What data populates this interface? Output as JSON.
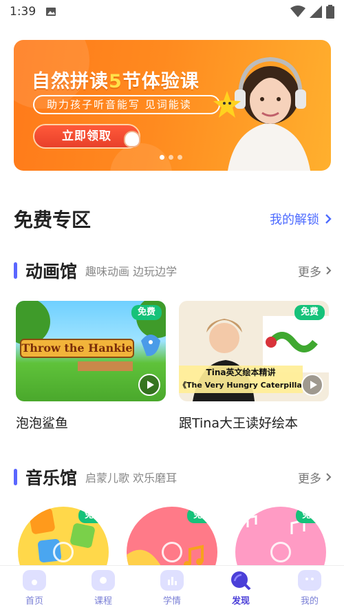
{
  "status_bar": {
    "time": "1:39"
  },
  "banner": {
    "title_a": "自然拼读",
    "title_num": "5",
    "title_b": "节体验课",
    "subtitle": "助力孩子听音能写 见词能读",
    "button": "立即领取",
    "page_count": 3,
    "active_page": 0
  },
  "free_zone": {
    "title": "免费专区",
    "link": "我的解锁"
  },
  "animation": {
    "name": "动画馆",
    "subtitle": "趣味动画 边玩边学",
    "more": "更多",
    "cards": [
      {
        "badge": "免费",
        "label": "泡泡鲨鱼",
        "thumb_text": "Throw the Hankie"
      },
      {
        "badge": "免费",
        "label": "跟Tina大王读好绘本",
        "thumb_line1": "Tina英文绘本精讲",
        "thumb_line2": "《The Very Hungry Caterpillar",
        "book_title": "The Very Hungry Caterpillar"
      }
    ]
  },
  "music": {
    "name": "音乐馆",
    "subtitle": "启蒙儿歌 欢乐磨耳",
    "more": "更多",
    "items": [
      {
        "badge": "免费"
      },
      {
        "badge": "免费"
      },
      {
        "badge": "免费"
      }
    ]
  },
  "tabbar": [
    {
      "label": "首页",
      "icon": "home-icon"
    },
    {
      "label": "课程",
      "icon": "course-icon"
    },
    {
      "label": "学情",
      "icon": "stats-icon"
    },
    {
      "label": "发现",
      "icon": "discover-icon",
      "active": true
    },
    {
      "label": "我的",
      "icon": "profile-icon"
    }
  ],
  "colors": {
    "accent": "#4b3fd8",
    "badge": "#16c27a",
    "banner": "#ff8a1f",
    "link": "#4d6bff"
  }
}
